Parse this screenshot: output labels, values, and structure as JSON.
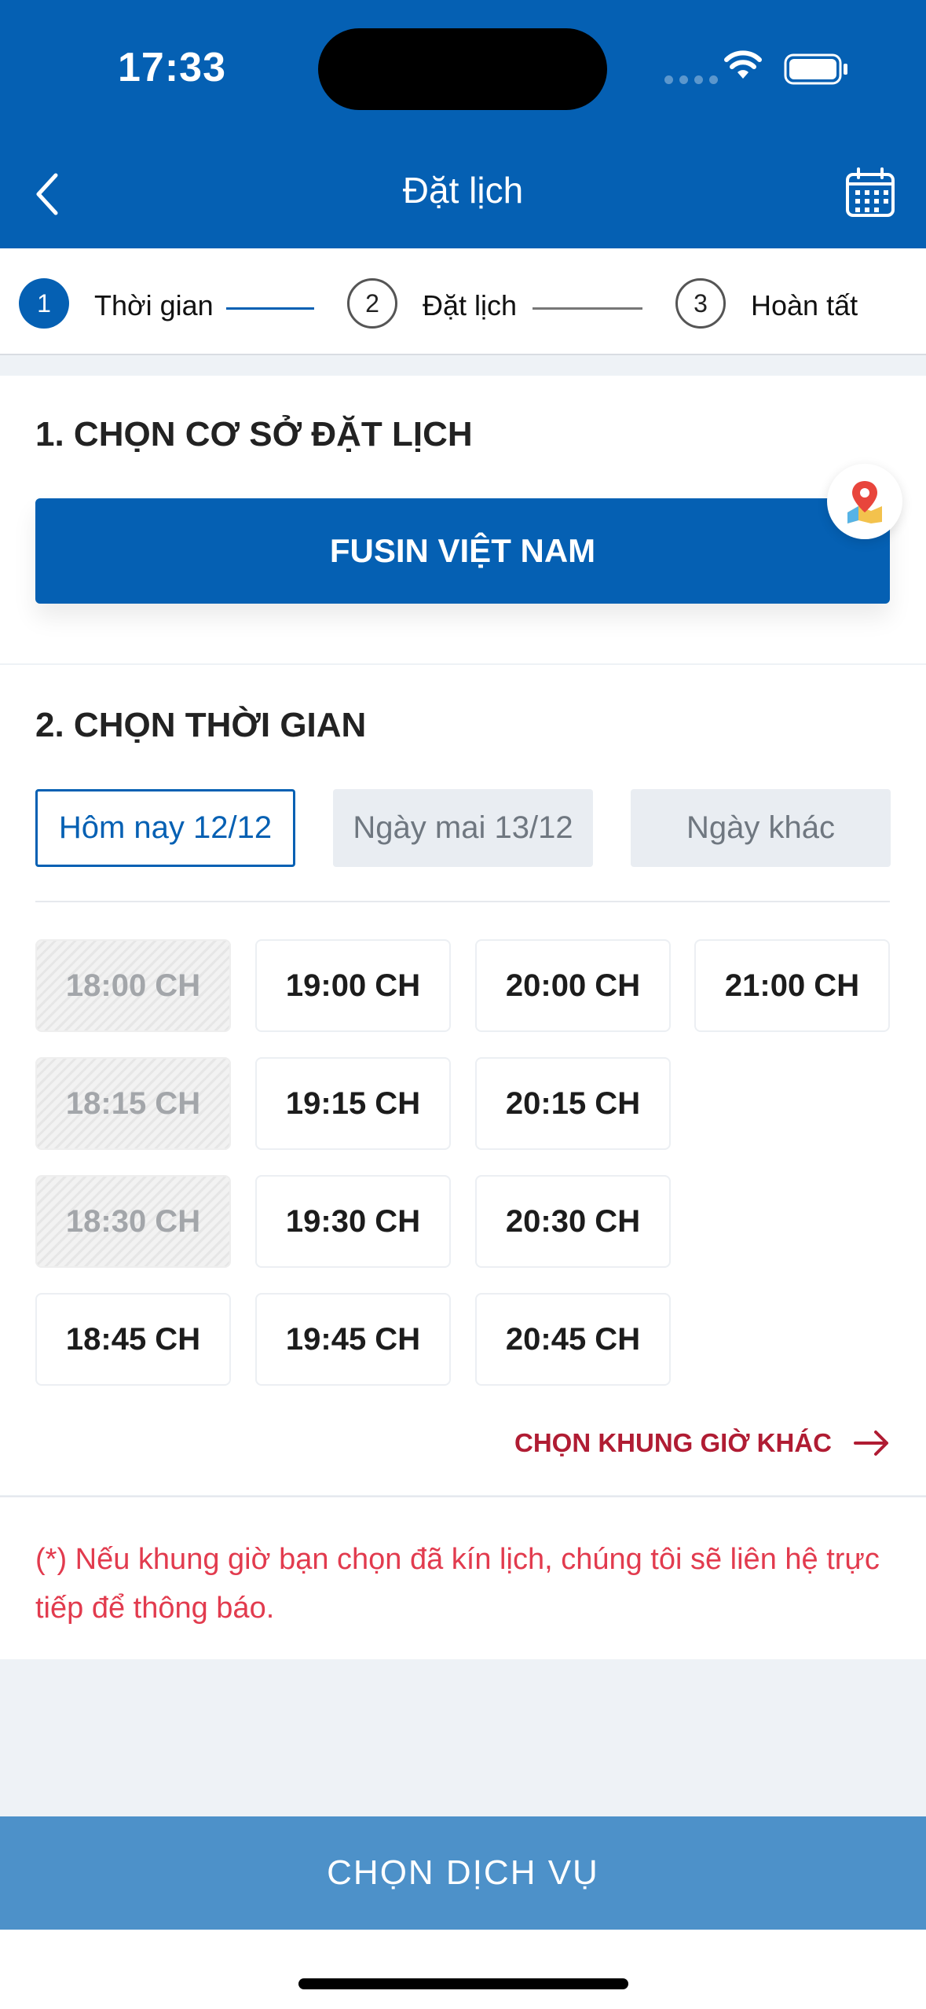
{
  "status_bar": {
    "time": "17:33"
  },
  "header": {
    "title": "Đặt lịch"
  },
  "stepper": {
    "steps": [
      {
        "number": "1",
        "label": "Thời gian",
        "active": true
      },
      {
        "number": "2",
        "label": "Đặt lịch",
        "active": false
      },
      {
        "number": "3",
        "label": "Hoàn tất",
        "active": false
      }
    ]
  },
  "section1": {
    "heading": "1. CHỌN CƠ SỞ ĐẶT LỊCH",
    "facility": "FUSIN VIỆT NAM"
  },
  "section2": {
    "heading": "2. CHỌN THỜI GIAN",
    "day_tabs": [
      {
        "label": "Hôm nay 12/12",
        "selected": true
      },
      {
        "label": "Ngày mai 13/12",
        "selected": false
      },
      {
        "label": "Ngày khác",
        "selected": false
      }
    ],
    "slots": [
      {
        "time": "18:00 CH",
        "available": false
      },
      {
        "time": "19:00 CH",
        "available": true
      },
      {
        "time": "20:00 CH",
        "available": true
      },
      {
        "time": "21:00 CH",
        "available": true
      },
      {
        "time": "18:15 CH",
        "available": false
      },
      {
        "time": "19:15 CH",
        "available": true
      },
      {
        "time": "20:15 CH",
        "available": true
      },
      {
        "time": "18:30 CH",
        "available": false
      },
      {
        "time": "19:30 CH",
        "available": true
      },
      {
        "time": "20:30 CH",
        "available": true
      },
      {
        "time": "18:45 CH",
        "available": true
      },
      {
        "time": "19:45 CH",
        "available": true
      },
      {
        "time": "20:45 CH",
        "available": true
      }
    ],
    "other_time_link": "CHỌN KHUNG GIỜ KHÁC"
  },
  "note": "(*) Nếu khung giờ bạn chọn đã kín lịch, chúng tôi sẽ liên hệ trực tiếp để thông báo.",
  "cta": {
    "label": "CHỌN DỊCH VỤ"
  },
  "colors": {
    "primary": "#0560b3",
    "accent_red": "#b01c33",
    "note_red": "#e23b4e",
    "cta": "#4d91c9"
  },
  "icons": [
    "back-chevron-icon",
    "calendar-icon",
    "map-pin-icon",
    "arrow-right-icon",
    "wifi-icon",
    "battery-icon"
  ]
}
